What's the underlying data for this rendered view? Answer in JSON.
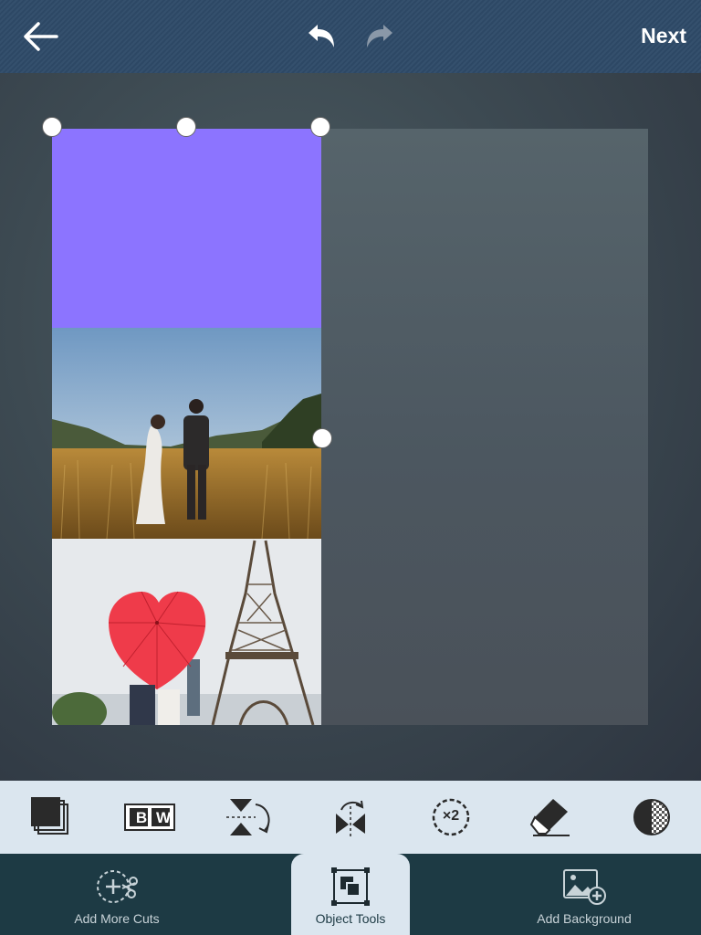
{
  "topbar": {
    "next_label": "Next"
  },
  "toolbar": {
    "tools": [
      {
        "name": "layers"
      },
      {
        "name": "black-white",
        "letters": [
          "B",
          "W"
        ]
      },
      {
        "name": "flip-vertical"
      },
      {
        "name": "flip-horizontal"
      },
      {
        "name": "duplicate",
        "label": "×2"
      },
      {
        "name": "eraser"
      },
      {
        "name": "opacity"
      }
    ]
  },
  "tabs": {
    "add_cuts": "Add More Cuts",
    "object_tools": "Object Tools",
    "add_background": "Add Background"
  },
  "colors": {
    "topbar": "#2e4a68",
    "purple_tile": "#8c74ff",
    "toolbar_bg": "#dbe6ef",
    "tabbar_bg": "#1d3a44"
  }
}
